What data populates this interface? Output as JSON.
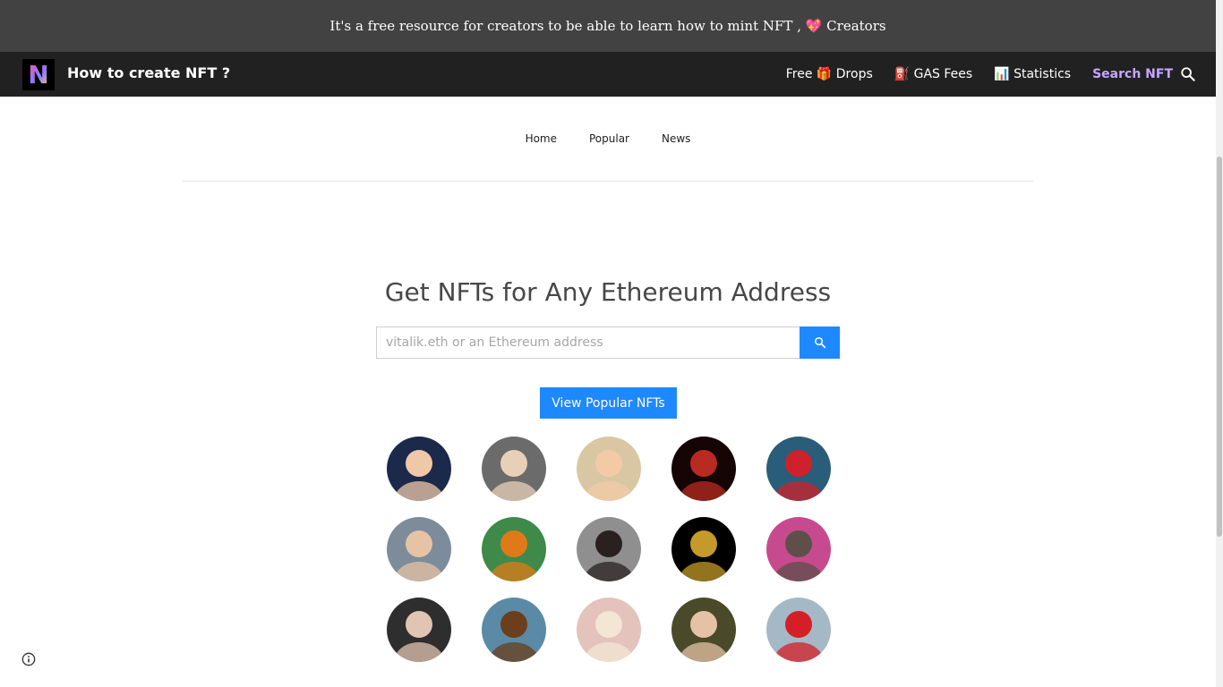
{
  "announcement": {
    "text": "It's a free resource for creators to be able to learn how to mint NFT , 💖 Creators"
  },
  "header": {
    "logo_letter": "N",
    "title": "How to create NFT ?",
    "links": [
      {
        "label": "Free 🎁 Drops"
      },
      {
        "label": "⛽ GAS Fees"
      },
      {
        "label": "📊 Statistics"
      },
      {
        "label": "Search NFT",
        "active": true
      }
    ],
    "search_icon": "search-icon"
  },
  "subnav": {
    "items": [
      "Home",
      "Popular",
      "News"
    ]
  },
  "main": {
    "headline": "Get NFTs for Any Ethereum Address",
    "search": {
      "placeholder": "vitalik.eth or an Ethereum address",
      "value": ""
    },
    "popular_button": "View Popular NFTs"
  },
  "avatars": [
    {
      "name": "avatar-1",
      "bg": "#1b2a4a",
      "fg": "#f0c8a8"
    },
    {
      "name": "avatar-2",
      "bg": "#6b6b6b",
      "fg": "#e8d0b8"
    },
    {
      "name": "avatar-3",
      "bg": "#d9c7a3",
      "fg": "#f2cba6"
    },
    {
      "name": "avatar-4",
      "bg": "#150505",
      "fg": "#b82a22"
    },
    {
      "name": "avatar-5",
      "bg": "#2a5d7a",
      "fg": "#d0202a"
    },
    {
      "name": "avatar-6",
      "bg": "#7d8c9a",
      "fg": "#e6c3a4"
    },
    {
      "name": "avatar-7",
      "bg": "#3f8a4a",
      "fg": "#e07a18"
    },
    {
      "name": "avatar-8",
      "bg": "#8f8f8f",
      "fg": "#2a2020"
    },
    {
      "name": "avatar-9",
      "bg": "#000000",
      "fg": "#c59a2a"
    },
    {
      "name": "avatar-10",
      "bg": "#c84a8e",
      "fg": "#5e4f4a"
    },
    {
      "name": "avatar-11",
      "bg": "#2e2e2e",
      "fg": "#e1c4b2"
    },
    {
      "name": "avatar-12",
      "bg": "#5a8aa5",
      "fg": "#6b3e1c"
    },
    {
      "name": "avatar-13",
      "bg": "#e3c3bc",
      "fg": "#f3e6d4"
    },
    {
      "name": "avatar-14",
      "bg": "#4a4a2a",
      "fg": "#e5c2a6"
    },
    {
      "name": "avatar-15",
      "bg": "#a5b8c6",
      "fg": "#d51f26"
    }
  ],
  "colors": {
    "accent": "#1e88ff",
    "announce_bg": "#424242",
    "nav_bg": "#212121",
    "active_link": "#c6a6ff"
  },
  "footer": {
    "info_icon": "info-icon"
  }
}
